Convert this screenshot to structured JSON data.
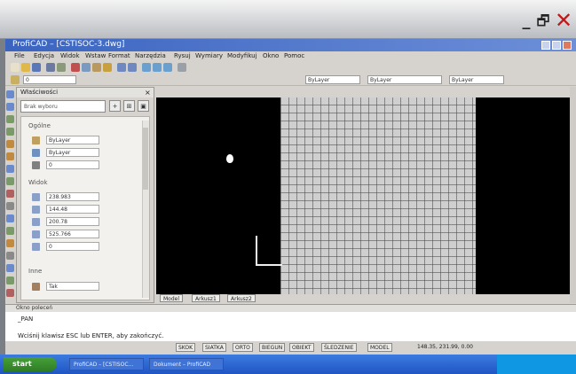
{
  "outer_window": {
    "minimize": "_",
    "restore": "🗗",
    "close": "✕"
  },
  "app": {
    "title": "ProfiCAD – [CSTISOC-3.dwg]",
    "menu": [
      "File",
      "Edycja",
      "Widok",
      "Wstaw",
      "Format",
      "Narzędzia",
      "Rysuj",
      "Wymiary",
      "Modyfikuj",
      "Okno",
      "Pomoc"
    ],
    "toolbar_fields": {
      "layer": "0",
      "color": "ByLayer",
      "linetype": "ByLayer",
      "lineweight": "ByLayer"
    }
  },
  "properties": {
    "title": "Właściwości",
    "close": "×",
    "selection": "Brak wyboru",
    "buttons": [
      "+",
      "⊞",
      "▣"
    ],
    "sections": {
      "general": "Ogólne",
      "view": "Widok",
      "other": "Inne"
    },
    "general_rows": [
      "ByLayer",
      "ByLayer",
      "0"
    ],
    "view_rows": [
      "238.983",
      "144.48",
      "200.78",
      "525.766",
      "0"
    ],
    "other_rows": [
      "Tak"
    ]
  },
  "layout_tabs": [
    "Model",
    "Arkusz1",
    "Arkusz2"
  ],
  "command": {
    "header": "Okno poleceń",
    "line1": "_PAN",
    "line2": "Wciśnij klawisz ESC lub ENTER, aby zakończyć."
  },
  "status": {
    "buttons": [
      "SKOK",
      "SIATKA",
      "ORTO",
      "BIEGUN",
      "OBIEKT",
      "ŚLEDZENIE",
      "MODEL"
    ],
    "coords": "148.35, 231.99, 0.00"
  },
  "taskbar": {
    "start": "start",
    "tasks": [
      "ProfiCAD – [CSTISOC...",
      "Dokument – ProfiCAD"
    ]
  }
}
